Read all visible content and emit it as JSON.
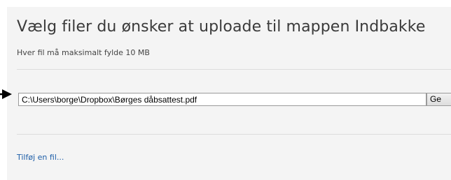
{
  "dialog": {
    "title": "Vælg filer du ønsker at uploade til mappen Indbakke",
    "size_note": "Hver fil må maksimalt fylde 10 MB"
  },
  "file_input": {
    "path_value": "C:\\Users\\borge\\Dropbox\\Børges dåbsattest.pdf",
    "browse_label": "Ge"
  },
  "add_file_link": "Tilføj en fil...",
  "colors": {
    "panel_background": "#f4f4f4",
    "link": "#1f5fa8",
    "title_text": "#3a3a3a"
  }
}
